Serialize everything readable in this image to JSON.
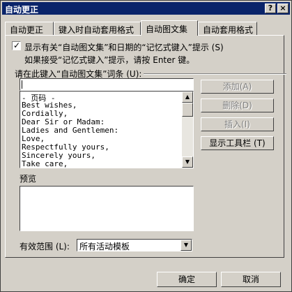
{
  "window": {
    "title": "自动更正",
    "help_btn": "?",
    "close_btn": "×"
  },
  "tabs": [
    {
      "label": "自动更正",
      "active": false
    },
    {
      "label": "键入时自动套用格式",
      "active": false
    },
    {
      "label": "自动图文集",
      "active": true
    },
    {
      "label": "自动套用格式",
      "active": false
    }
  ],
  "autotext": {
    "show_tip_label": "显示有关“自动图文集”和日期的“记忆式键入”提示 (S)",
    "show_tip_checked": true,
    "check_mark": "✓",
    "tip_hint": "如果接受“记忆式键入”提示，请按 Enter 键。",
    "entry_group_label": "请在此键入“自动图文集”词条 (U):",
    "entry_value": "",
    "entries": [
      "- 页码 -",
      "Best wishes,",
      "Cordially,",
      "Dear Sir or Madam:",
      "Ladies and Gentlemen:",
      "Love,",
      "Respectfully yours,",
      "Sincerely yours,",
      "Take care,"
    ],
    "scroll_up": "▲",
    "scroll_down": "▼",
    "add_label": "添加(A)",
    "delete_label": "删除(D)",
    "insert_label": "插入(I)",
    "toolbar_label": "显示工具栏 (T)",
    "preview_label": "预览",
    "scope_label": "有效范围 (L):",
    "scope_value": "所有活动模板",
    "dropdown_arrow": "▼"
  },
  "footer": {
    "ok_label": "确定",
    "cancel_label": "取消"
  }
}
